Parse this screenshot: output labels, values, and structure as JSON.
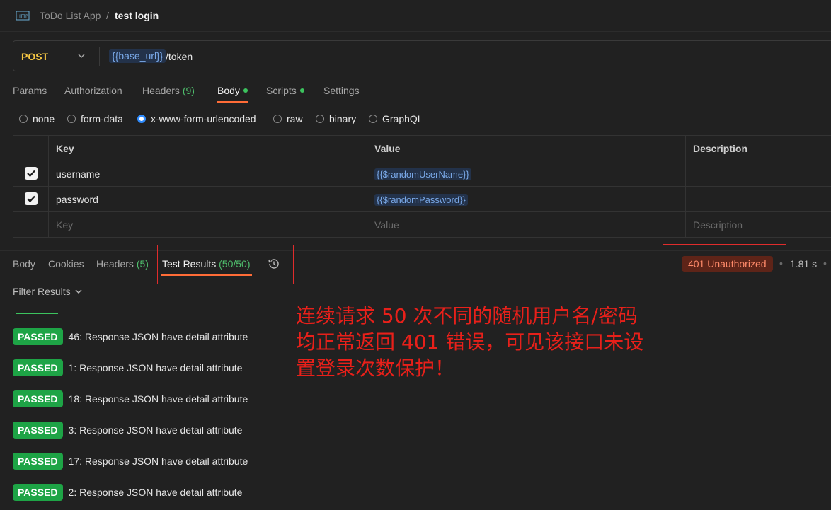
{
  "header": {
    "app": "ToDo List App",
    "separator": "/",
    "request_name": "test login"
  },
  "request": {
    "method": "POST",
    "url_variable": "{{base_url}}",
    "url_path": "/token",
    "method_color": "#f5c643"
  },
  "request_tabs": [
    {
      "label": "Params"
    },
    {
      "label": "Authorization"
    },
    {
      "label": "Headers",
      "count": "(9)"
    },
    {
      "label": "Body",
      "active": true,
      "dot": true
    },
    {
      "label": "Scripts",
      "dot": true
    },
    {
      "label": "Settings"
    }
  ],
  "body_types": [
    "none",
    "form-data",
    "x-www-form-urlencoded",
    "raw",
    "binary",
    "GraphQL"
  ],
  "body_type_selected": "x-www-form-urlencoded",
  "params_table": {
    "headers": {
      "key": "Key",
      "value": "Value",
      "description": "Description"
    },
    "rows": [
      {
        "checked": true,
        "key": "username",
        "value": "{{$randomUserName}}",
        "description": ""
      },
      {
        "checked": true,
        "key": "password",
        "value": "{{$randomPassword}}",
        "description": ""
      }
    ],
    "placeholder": {
      "key": "Key",
      "value": "Value",
      "description": "Description"
    }
  },
  "response_tabs": [
    {
      "label": "Body"
    },
    {
      "label": "Cookies"
    },
    {
      "label": "Headers",
      "count": "(5)"
    },
    {
      "label": "Test Results",
      "count": "(50/50)",
      "active": true
    }
  ],
  "response_status": {
    "status": "401 Unauthorized",
    "time": "1.81 s",
    "status_color": "#ff8a6a"
  },
  "filter_label": "Filter Results",
  "test_results": [
    {
      "badge": "PASSED",
      "text": "46: Response JSON have detail attribute"
    },
    {
      "badge": "PASSED",
      "text": "1: Response JSON have detail attribute"
    },
    {
      "badge": "PASSED",
      "text": "18: Response JSON have detail attribute"
    },
    {
      "badge": "PASSED",
      "text": "3: Response JSON have detail attribute"
    },
    {
      "badge": "PASSED",
      "text": "17: Response JSON have detail attribute"
    },
    {
      "badge": "PASSED",
      "text": "2: Response JSON have detail attribute"
    }
  ],
  "annotation": {
    "lines": [
      "连续请求 50 次不同的随机用户名/密码",
      "均正常返回 401 错误，可见该接口未设",
      "置登录次数保护！"
    ],
    "color": "#e8201a"
  }
}
